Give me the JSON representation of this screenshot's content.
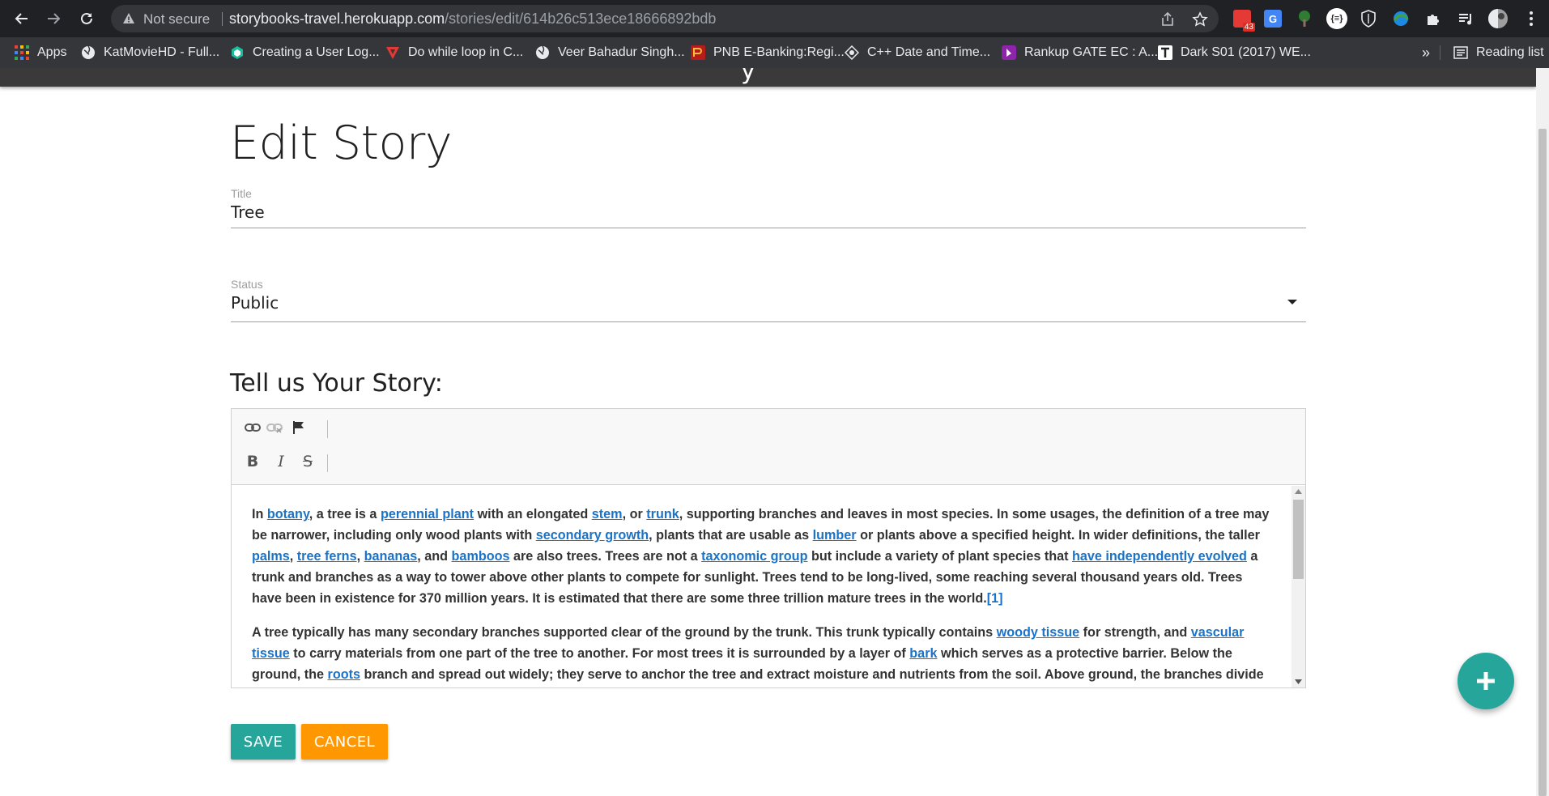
{
  "browser": {
    "security_label": "Not secure",
    "url_host": "storybooks-travel.herokuapp.com",
    "url_path": "/stories/edit/614b26c513ece18666892bdb",
    "extension_badge": "43",
    "bookmarks": [
      {
        "label": "Apps",
        "color": "#ea4335"
      },
      {
        "label": "KatMovieHD - Full...",
        "color": "#e8eaed"
      },
      {
        "label": "Creating a User Log...",
        "color": "#1abc9c"
      },
      {
        "label": "Do while loop in C...",
        "color": "#e53935"
      },
      {
        "label": "Veer Bahadur Singh...",
        "color": "#e8eaed"
      },
      {
        "label": "PNB E-Banking:Regi...",
        "color": "#b71c1c"
      },
      {
        "label": "C++ Date and Time...",
        "color": "#e8eaed"
      },
      {
        "label": "Rankup GATE EC : A...",
        "color": "#8e24aa"
      },
      {
        "label": "Dark S01 (2017) WE...",
        "color": "#ffffff"
      }
    ],
    "overflow_label": "»",
    "reading_list_label": "Reading list"
  },
  "page": {
    "title": "Edit Story",
    "title_field": {
      "label": "Title",
      "value": "Tree"
    },
    "status_field": {
      "label": "Status",
      "value": "Public"
    },
    "story_heading": "Tell us Your Story:",
    "buttons": {
      "save": "SAVE",
      "cancel": "CANCEL"
    }
  },
  "editor": {
    "toolbar": [
      "link",
      "unlink",
      "anchor",
      "bold",
      "italic",
      "strikethrough"
    ],
    "paragraphs": [
      [
        {
          "t": "In "
        },
        {
          "t": "botany",
          "link": true
        },
        {
          "t": ", a tree is a "
        },
        {
          "t": "perennial plant",
          "link": true
        },
        {
          "t": " with an elongated "
        },
        {
          "t": "stem",
          "link": true
        },
        {
          "t": ", or "
        },
        {
          "t": "trunk",
          "link": true
        },
        {
          "t": ", supporting branches and leaves in most species. In some usages, the definition of a tree may be narrower, including only wood plants with "
        },
        {
          "t": "secondary growth",
          "link": true
        },
        {
          "t": ", plants that are usable as "
        },
        {
          "t": "lumber",
          "link": true
        },
        {
          "t": " or plants above a specified height. In wider definitions, the taller "
        },
        {
          "t": "palms",
          "link": true
        },
        {
          "t": ", "
        },
        {
          "t": "tree ferns",
          "link": true
        },
        {
          "t": ", "
        },
        {
          "t": "bananas",
          "link": true
        },
        {
          "t": ", and "
        },
        {
          "t": "bamboos",
          "link": true
        },
        {
          "t": " are also trees. Trees are not a "
        },
        {
          "t": "taxonomic group",
          "link": true
        },
        {
          "t": " but include a variety of plant species that "
        },
        {
          "t": "have independently evolved",
          "link": true
        },
        {
          "t": " a trunk and branches as a way to tower above other plants to compete for sunlight. Trees tend to be long-lived, some reaching several thousand years old. Trees have been in existence for 370 million years. It is estimated that there are some three trillion mature trees in the world."
        },
        {
          "t": "[1]",
          "link": true,
          "cite": true
        }
      ],
      [
        {
          "t": "A tree typically has many secondary branches supported clear of the ground by the trunk. This trunk typically contains "
        },
        {
          "t": "woody tissue",
          "link": true
        },
        {
          "t": " for strength, and "
        },
        {
          "t": "vascular tissue",
          "link": true
        },
        {
          "t": " to carry materials from one part of the tree to another. For most trees it is surrounded by a layer of "
        },
        {
          "t": "bark",
          "link": true
        },
        {
          "t": " which serves as a protective barrier. Below the ground, the "
        },
        {
          "t": "roots",
          "link": true
        },
        {
          "t": " branch and spread out widely; they serve to anchor the tree and extract moisture and nutrients from the soil. Above ground, the branches divide"
        }
      ]
    ]
  },
  "colors": {
    "save": "#26a69a",
    "cancel": "#ff9800",
    "fab": "#26a69a",
    "link": "#1a73c8"
  }
}
